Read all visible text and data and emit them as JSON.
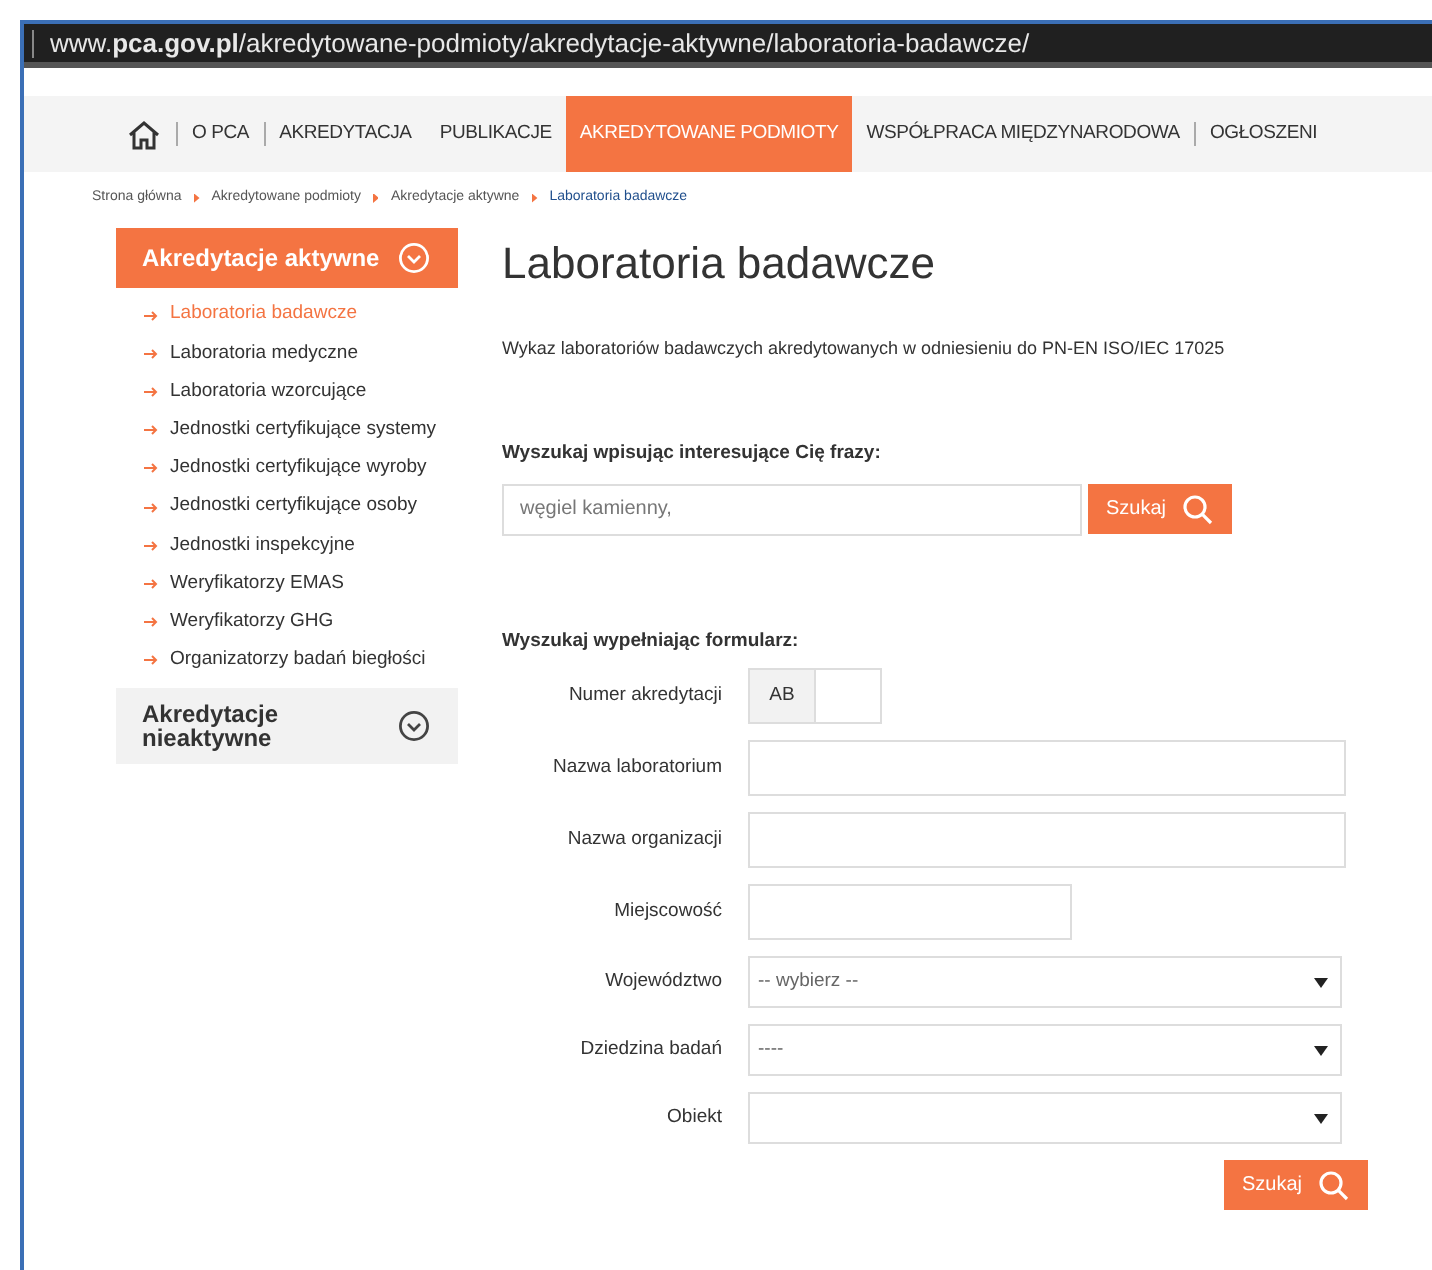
{
  "address_bar": {
    "url": "www.**pca.gov.pl**/akredytowane-podmioty/akredytacje-aktywne/laboratoria-badawcze/"
  },
  "nav": {
    "items": [
      {
        "label": "O PCA",
        "selected": false,
        "divider": true
      },
      {
        "label": "AKREDYTACJA",
        "selected": false,
        "divider": true
      },
      {
        "label": "PUBLIKACJE",
        "selected": false,
        "divider": false
      },
      {
        "label": "AKREDYTOWANE PODMIOTY",
        "selected": true,
        "divider": false
      },
      {
        "label": "WSPÓŁPRACA MIĘDZYNARODOWA",
        "selected": false,
        "divider": false
      },
      {
        "label": "OGŁOSZENI",
        "selected": false,
        "divider": true
      }
    ]
  },
  "breadcrumb": [
    {
      "label": "Strona główna",
      "selected": false
    },
    {
      "label": "Akredytowane podmioty",
      "selected": false
    },
    {
      "label": "Akredytacje aktywne",
      "selected": false
    },
    {
      "label": "Laboratoria badawcze",
      "selected": true
    }
  ],
  "sidebar": {
    "sections": [
      {
        "title": "Akredytacje aktywne",
        "expanded": true,
        "items": [
          {
            "label": "Laboratoria badawcze",
            "selected": true
          },
          {
            "label": "Laboratoria medyczne",
            "selected": false
          },
          {
            "label": "Laboratoria wzorcujące",
            "selected": false
          },
          {
            "label": "Jednostki certyfikujące systemy",
            "selected": false
          },
          {
            "label": "Jednostki certyfikujące wyroby",
            "selected": false
          },
          {
            "label": "Jednostki certyfikujące osoby",
            "selected": false
          },
          {
            "label": "Jednostki inspekcyjne",
            "selected": false
          },
          {
            "label": "Weryfikatorzy EMAS",
            "selected": false
          },
          {
            "label": "Weryfikatorzy GHG",
            "selected": false
          },
          {
            "label": "Organizatorzy badań biegłości",
            "selected": false
          }
        ]
      },
      {
        "title": "Akredytacje nieaktywne",
        "expanded": false
      }
    ]
  },
  "page": {
    "title": "Laboratoria badawcze",
    "description": "Wykaz laboratoriów badawczych akredytowanych w odniesieniu do PN-EN ISO/IEC 17025"
  },
  "phrase_search": {
    "heading": "Wyszukaj wpisując interesujące Cię frazy:",
    "placeholder": "węgiel kamienny,",
    "button": "Szukaj"
  },
  "form": {
    "heading": "Wyszukaj wypełniając formularz:",
    "fields": [
      {
        "label": "Numer akredytacji",
        "kind": "prefixed",
        "prefix": "AB"
      },
      {
        "label": "Nazwa laboratorium",
        "kind": "wide"
      },
      {
        "label": "Nazwa organizacji",
        "kind": "wide"
      },
      {
        "label": "Miejscowość",
        "kind": "short"
      },
      {
        "label": "Województwo",
        "kind": "select",
        "value": "-- wybierz --"
      },
      {
        "label": "Dziedzina badań",
        "kind": "select",
        "value": "----"
      },
      {
        "label": "Obiekt",
        "kind": "select"
      }
    ],
    "button": "Szukaj"
  }
}
